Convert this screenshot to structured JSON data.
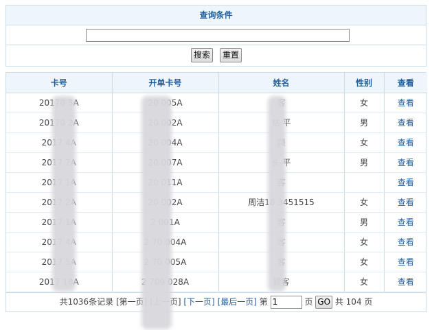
{
  "search": {
    "title": "查询条件",
    "input_value": "",
    "search_label": "搜索",
    "reset_label": "重置"
  },
  "table": {
    "headers": [
      "卡号",
      "开单卡号",
      "姓名",
      "性别",
      "查看"
    ],
    "rows": [
      {
        "card": "20170  5A",
        "open_card": "20  005A",
        "name": "客",
        "gender": "女",
        "view": "查看"
      },
      {
        "card": "20170  2A",
        "open_card": "20  002A",
        "name": "枯  平",
        "gender": "男",
        "view": "查看"
      },
      {
        "card": "2017  4A",
        "open_card": "20  004A",
        "name": "颜",
        "gender": "女",
        "view": "查看"
      },
      {
        "card": "2017  7A",
        "open_card": "20  007A",
        "name": "头  平",
        "gender": "男",
        "view": "查看"
      },
      {
        "card": "2017  1A",
        "open_card": "20  011A",
        "name": "客",
        "gender": "",
        "view": "查看"
      },
      {
        "card": "2017  2A",
        "open_card": "20  002A",
        "name": "周洁18  3451515",
        "gender": "女",
        "view": "查看"
      },
      {
        "card": "2017  1A",
        "open_card": "2  001A",
        "name": "客",
        "gender": "男",
        "view": "查看"
      },
      {
        "card": "2017  4A",
        "open_card": "2  70  004A",
        "name": "客",
        "gender": "女",
        "view": "查看"
      },
      {
        "card": "2017  5A",
        "open_card": "2  70  005A",
        "name": "客",
        "gender": "女",
        "view": "查看"
      },
      {
        "card": "2017  18A",
        "open_card": "2  709  028A",
        "name": "顾客",
        "gender": "女",
        "view": "查看"
      }
    ]
  },
  "pager": {
    "total_text": "共1036条记录",
    "first": "[第一页]",
    "prev": "[上一页]",
    "next": "[下一页]",
    "last": "[最后一页]",
    "page_prefix": "第",
    "page_value": "1",
    "page_suffix": "页",
    "go_label": "GO",
    "total_pages_text": "共 104 页"
  },
  "colors": {
    "header_bg": "#eef5fb",
    "header_text": "#1f5d9c",
    "border": "#c9dcea",
    "link": "#1f5d9c"
  }
}
